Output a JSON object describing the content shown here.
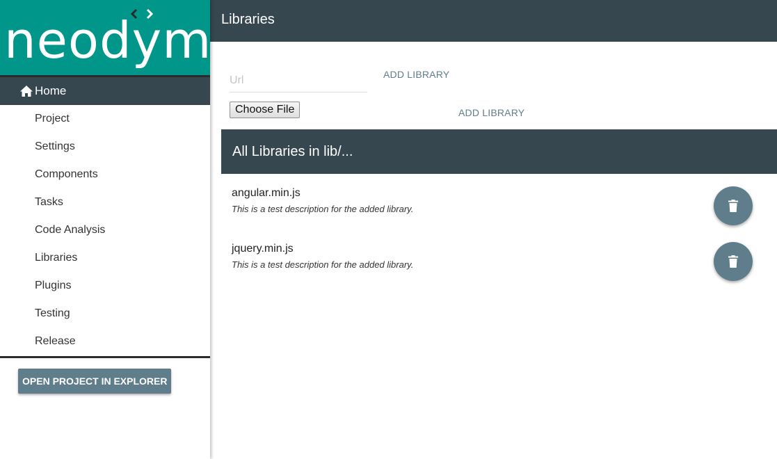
{
  "logo": {
    "text": "neodym"
  },
  "sidebar": {
    "home_label": "Home",
    "items": [
      {
        "label": "Project"
      },
      {
        "label": "Settings"
      },
      {
        "label": "Components"
      },
      {
        "label": "Tasks"
      },
      {
        "label": "Code Analysis"
      },
      {
        "label": "Libraries"
      },
      {
        "label": "Plugins"
      },
      {
        "label": "Testing"
      },
      {
        "label": "Release"
      }
    ],
    "open_explorer_label": "OPEN PROJECT IN EXPLORER"
  },
  "header": {
    "title": "Libraries"
  },
  "add_form": {
    "url_placeholder": "Url",
    "url_value": "",
    "add_library_label": "ADD LIBRARY",
    "choose_file_label": "Choose File",
    "add_library_file_label": "ADD LIBRARY"
  },
  "libraries_section": {
    "title": "All Libraries in lib/...",
    "items": [
      {
        "name": "angular.min.js",
        "description": "This is a test description for the added library."
      },
      {
        "name": "jquery.min.js",
        "description": "This is a test description for the added library."
      }
    ]
  },
  "colors": {
    "logo_bg": "#00968a",
    "header_bg": "#37474f",
    "accent": "#607d8b"
  },
  "icons": {
    "home": "home-icon",
    "delete": "trash-icon"
  }
}
